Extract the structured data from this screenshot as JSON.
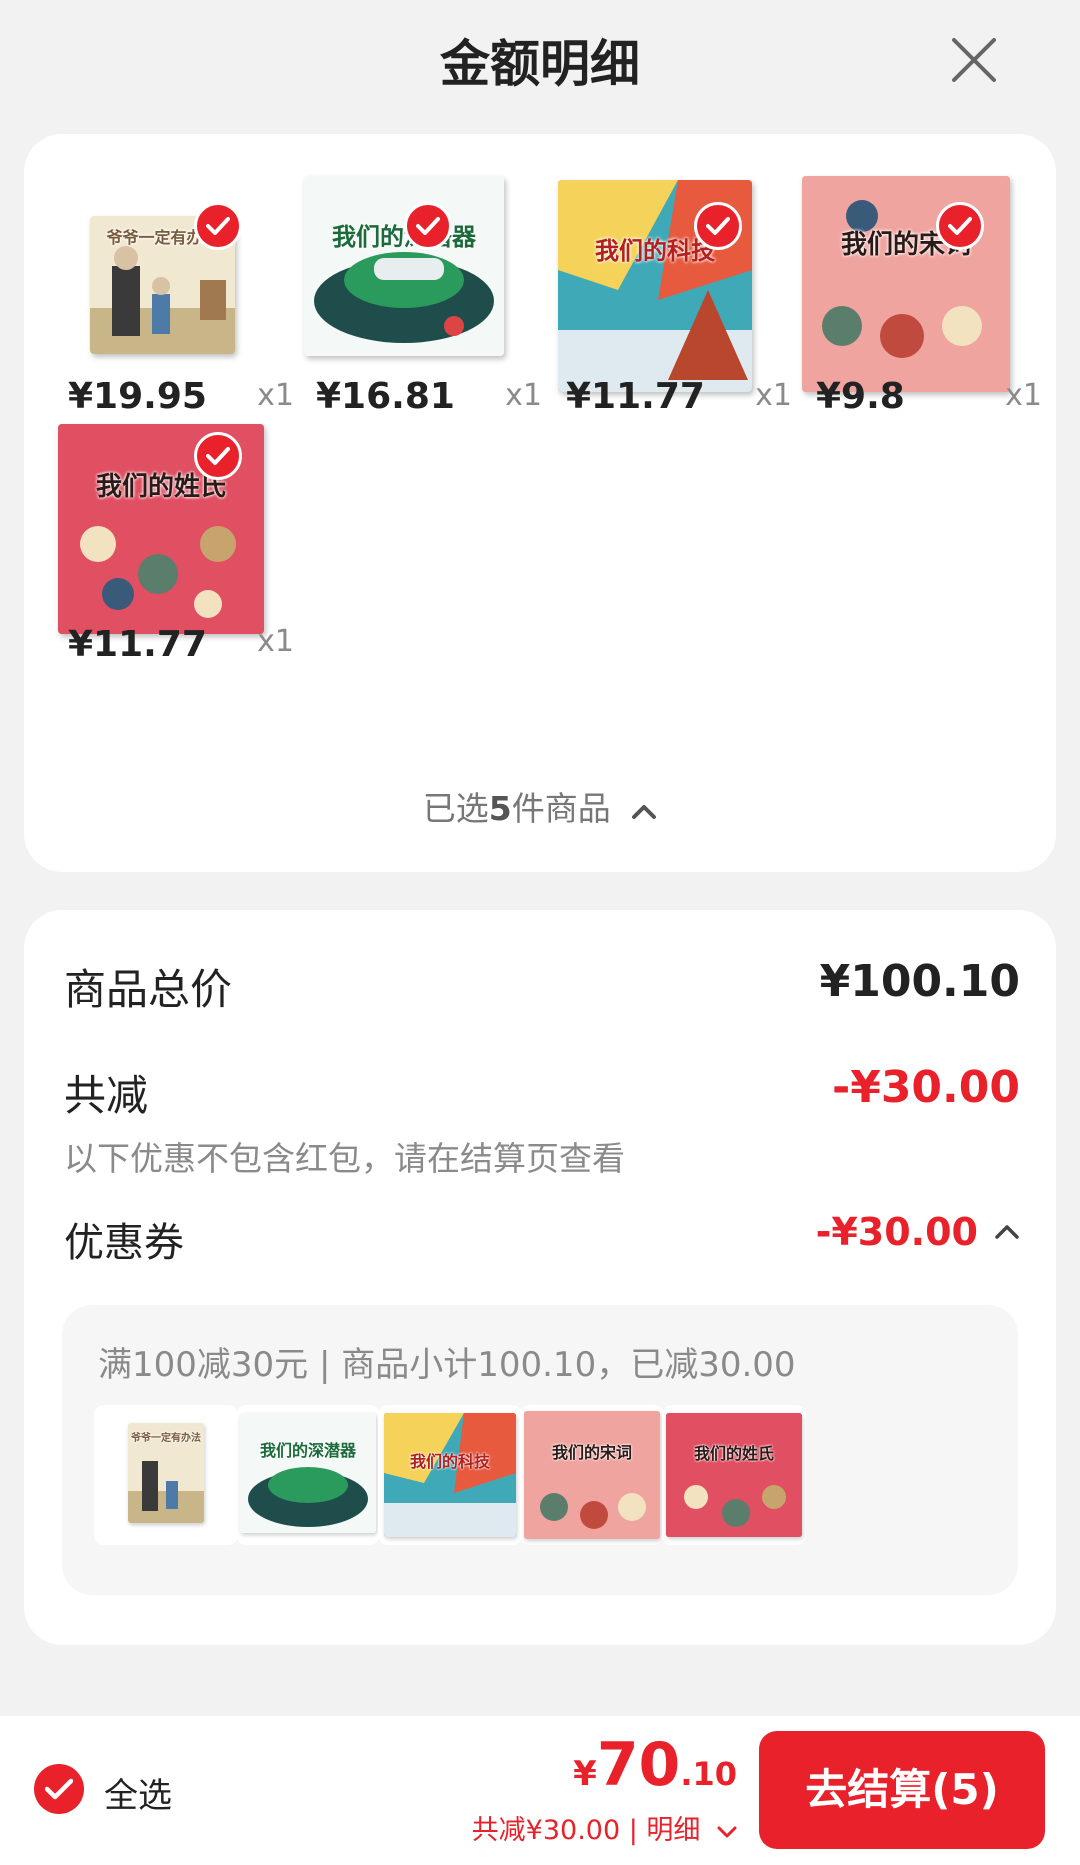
{
  "header": {
    "title": "金额明细"
  },
  "products": [
    {
      "cover_title": "爷爷一定有办法",
      "price": "¥19.95",
      "qty": "x1",
      "bg": "#f1e8d2"
    },
    {
      "cover_title": "我们的深潜器",
      "price": "¥16.81",
      "qty": "x1",
      "bg": "#eef6f3"
    },
    {
      "cover_title": "我们的科技",
      "price": "¥11.77",
      "qty": "x1",
      "bg": "#f5d35b"
    },
    {
      "cover_title": "我们的宋词",
      "price": "¥9.8",
      "qty": "x1",
      "bg": "#e98e8e"
    },
    {
      "cover_title": "我们的姓氏",
      "price": "¥11.77",
      "qty": "x1",
      "bg": "#e04f62"
    }
  ],
  "selection": {
    "prefix": "已选",
    "count": "5",
    "suffix": "件商品"
  },
  "summary": {
    "total_label": "商品总价",
    "total_value": "¥100.10",
    "discount_label": "共减",
    "discount_value": "-¥30.00",
    "note": "以下优惠不包含红包，请在结算页查看",
    "coupon_label": "优惠券",
    "coupon_value": "-¥30.00",
    "coupon_desc": "满100减30元 | 商品小计100.10，已减30.00"
  },
  "bottom_bar": {
    "select_all": "全选",
    "total_symbol": "¥",
    "total_int": "70",
    "total_dec": ".10",
    "total_detail": "共减¥30.00 | 明细",
    "checkout": "去结算(5)"
  },
  "colors": {
    "accent": "#e8212b",
    "background": "#f2f2f2"
  }
}
